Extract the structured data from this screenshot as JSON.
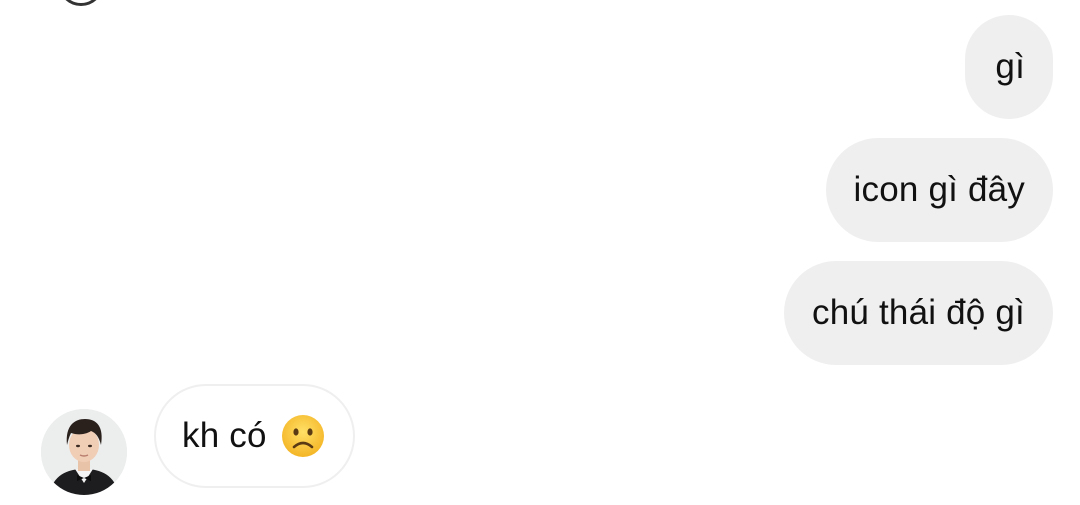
{
  "conversation": {
    "messages": [
      {
        "direction": "outgoing",
        "text": "gì"
      },
      {
        "direction": "outgoing",
        "text": "icon gì đây"
      },
      {
        "direction": "outgoing",
        "text": "chú thái độ gì"
      },
      {
        "direction": "incoming",
        "text": "kh có",
        "emoji": "frowning-face-icon"
      }
    ]
  },
  "colors": {
    "outgoing_bubble": "#efefef",
    "incoming_bubble_border": "#efefef",
    "text": "#111111",
    "emoji_face": "#ffcc33"
  }
}
